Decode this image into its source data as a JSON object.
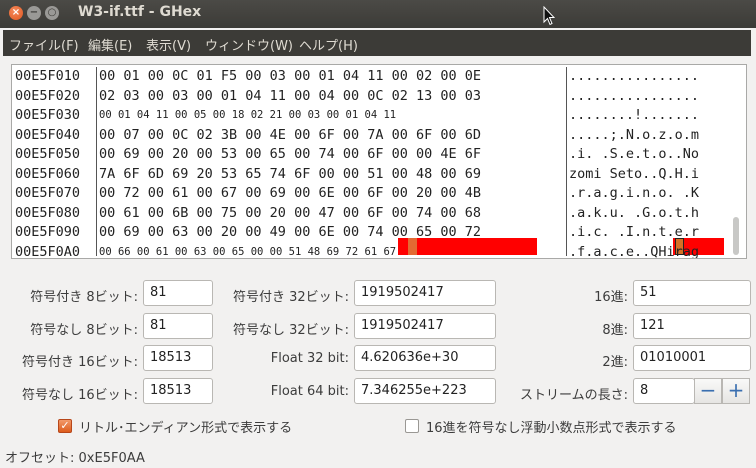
{
  "window": {
    "title": "W3-if.ttf - GHex",
    "close_glyph": "×",
    "minimize_glyph": "−",
    "maximize_glyph": "○"
  },
  "menu": [
    "ファイル(F)",
    "編集(E)",
    "表示(V)",
    "ウィンドウ(W)",
    "ヘルプ(H)"
  ],
  "hex_view": {
    "offsets": [
      "00E5F010",
      "00E5F020",
      "00E5F030",
      "00E5F040",
      "00E5F050",
      "00E5F060",
      "00E5F070",
      "00E5F080",
      "00E5F090",
      "00E5F0A0"
    ],
    "hex_rows": [
      "00 01 00 0C 01 F5 00 03 00 01 04 11 00 02 00 0E",
      "02 03 00 03 00 01 04 11 00 04 00 0C 02 13 00 03",
      "00 01 04 11 00 05 00 18 02 21 00 03 00 01 04 11",
      "00 07 00 0C 02 3B 00 4E 00 6F 00 7A 00 6F 00 6D",
      "00 69 00 20 00 53 00 65 00 74 00 6F 00 00 4E 6F",
      "7A 6F 6D 69 20 53 65 74 6F 00 00 51 00 48 00 69",
      "00 72 00 61 00 67 00 69 00 6E 00 6F 00 20 00 4B",
      "00 61 00 6B 00 75 00 20 00 47 00 6F 00 74 00 68",
      "00 69 00 63 00 20 00 49 00 6E 00 74 00 65 00 72",
      "00 66 00 61 00 63 00 65 00 00 51 48 69 72 61 67"
    ],
    "ascii_rows": [
      "................",
      "................",
      "........!.......",
      ".....;.N.o.z.o.m",
      ".i. .S.e.t.o..No",
      "zomi Seto..Q.H.i",
      ".r.a.g.i.n.o. .K",
      ".a.k.u. .G.o.t.h",
      ".i.c. .I.n.t.e.r",
      ".f.a.c.e..QHirag"
    ],
    "accent": "#ff0000",
    "cursor_color": "#e36a33"
  },
  "fields": {
    "s8_label": "符号付き 8ビット:",
    "s8_value": "81",
    "u8_label": "符号なし 8ビット:",
    "u8_value": "81",
    "s16_label": "符号付き 16ビット:",
    "s16_value": "18513",
    "u16_label": "符号なし 16ビット:",
    "u16_value": "18513",
    "s32_label": "符号付き 32ビット:",
    "s32_value": "1919502417",
    "u32_label": "符号なし 32ビット:",
    "u32_value": "1919502417",
    "f32_label": "Float 32 bit:",
    "f32_value": "4.620636e+30",
    "f64_label": "Float 64 bit:",
    "f64_value": "7.346255e+223",
    "hex_label": "16進:",
    "hex_value": "51",
    "oct_label": "8進:",
    "oct_value": "121",
    "bin_label": "2進:",
    "bin_value": "01010001",
    "stream_label": "ストリームの長さ:",
    "stream_value": "8"
  },
  "spin": {
    "minus": "−",
    "plus": "+"
  },
  "options": {
    "little_endian_label": "リトル･エンディアン形式で表示する",
    "little_endian_checked": true,
    "unsigned_hex_float_label": "16進を符号なし浮動小数点形式で表示する",
    "unsigned_hex_float_checked": false,
    "check_glyph": "✓"
  },
  "status": {
    "offset": "オフセット: 0xE5F0AA"
  }
}
